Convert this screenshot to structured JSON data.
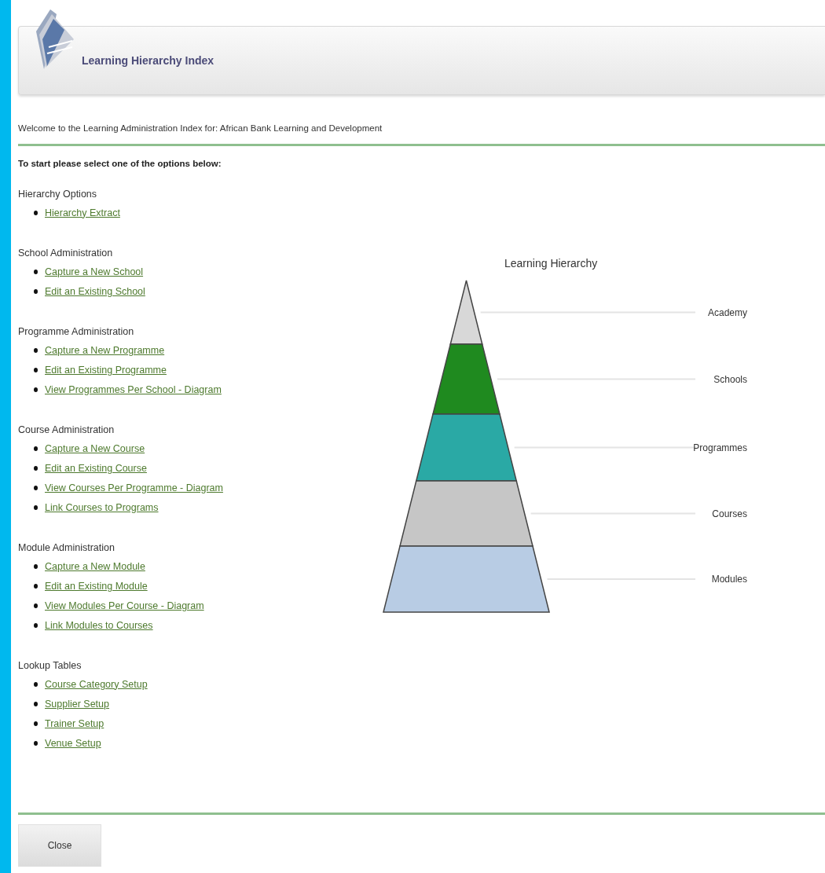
{
  "header": {
    "title": "Learning Hierarchy Index"
  },
  "welcome": "Welcome to the Learning Administration Index for: African Bank Learning and Development",
  "instruction": "To start please select one of the options below:",
  "sections": [
    {
      "title": "Hierarchy Options",
      "links": [
        "Hierarchy Extract"
      ]
    },
    {
      "title": "School Administration",
      "links": [
        "Capture a New School",
        "Edit an Existing School"
      ]
    },
    {
      "title": "Programme Administration",
      "links": [
        "Capture a New Programme",
        "Edit an Existing Programme",
        "View Programmes Per School - Diagram"
      ]
    },
    {
      "title": "Course Administration",
      "links": [
        "Capture a New Course",
        "Edit an Existing Course",
        "View Courses Per Programme - Diagram",
        "Link Courses to Programs"
      ]
    },
    {
      "title": "Module Administration",
      "links": [
        "Capture a New Module",
        "Edit an Existing Module",
        "View Modules Per Course - Diagram",
        "Link Modules to Courses"
      ]
    },
    {
      "title": "Lookup Tables",
      "links": [
        "Course Category Setup",
        "Supplier Setup",
        "Trainer Setup",
        "Venue Setup"
      ]
    }
  ],
  "diagram": {
    "title": "Learning Hierarchy",
    "layers": [
      {
        "label": "Academy",
        "color": "#d8d8d8"
      },
      {
        "label": "Schools",
        "color": "#1f8a1f"
      },
      {
        "label": "Programmes",
        "color": "#2aa9a5"
      },
      {
        "label": "Courses",
        "color": "#c6c6c6"
      },
      {
        "label": "Modules",
        "color": "#b8cce4"
      }
    ]
  },
  "close_button": "Close"
}
